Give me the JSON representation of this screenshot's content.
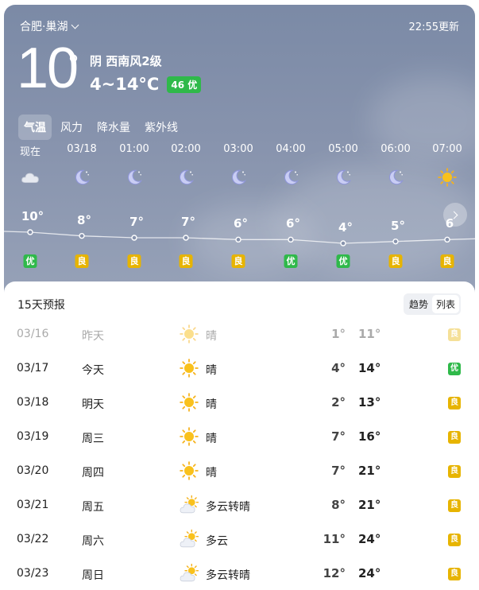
{
  "header": {
    "location": "合肥·巢湖",
    "update_time": "22:55更新",
    "current_temp": "10",
    "degree": "°",
    "weather_line": "阴  西南风2级",
    "temp_range": "4~14°C",
    "aqi_badge": "46 优"
  },
  "tabs": [
    "气温",
    "风力",
    "降水量",
    "紫外线"
  ],
  "hourly": [
    {
      "time": "现在",
      "icon": "cloud-icon",
      "temp": "10°",
      "t": 10,
      "aqi": "优"
    },
    {
      "time": "03/18",
      "icon": "moon-icon",
      "temp": "8°",
      "t": 8,
      "aqi": "良"
    },
    {
      "time": "01:00",
      "icon": "moon-icon",
      "temp": "7°",
      "t": 7,
      "aqi": "良"
    },
    {
      "time": "02:00",
      "icon": "moon-icon",
      "temp": "7°",
      "t": 7,
      "aqi": "良"
    },
    {
      "time": "03:00",
      "icon": "moon-icon",
      "temp": "6°",
      "t": 6,
      "aqi": "良"
    },
    {
      "time": "04:00",
      "icon": "moon-icon",
      "temp": "6°",
      "t": 6,
      "aqi": "优"
    },
    {
      "time": "05:00",
      "icon": "moon-icon",
      "temp": "4°",
      "t": 4,
      "aqi": "优"
    },
    {
      "time": "06:00",
      "icon": "moon-icon",
      "temp": "5°",
      "t": 5,
      "aqi": "良"
    },
    {
      "time": "07:00",
      "icon": "sun-icon",
      "temp": "6",
      "t": 6,
      "aqi": "良"
    }
  ],
  "forecast": {
    "title": "15天预报",
    "toggle": [
      "趋势",
      "列表"
    ],
    "days": [
      {
        "date": "03/16",
        "day": "昨天",
        "icon": "sun-icon",
        "desc": "晴",
        "lo": "1°",
        "hi": "11°",
        "aqi": "良",
        "past": true
      },
      {
        "date": "03/17",
        "day": "今天",
        "icon": "sun-icon",
        "desc": "晴",
        "lo": "4°",
        "hi": "14°",
        "aqi": "优",
        "past": false
      },
      {
        "date": "03/18",
        "day": "明天",
        "icon": "sun-icon",
        "desc": "晴",
        "lo": "2°",
        "hi": "13°",
        "aqi": "良",
        "past": false
      },
      {
        "date": "03/19",
        "day": "周三",
        "icon": "sun-icon",
        "desc": "晴",
        "lo": "7°",
        "hi": "16°",
        "aqi": "良",
        "past": false
      },
      {
        "date": "03/20",
        "day": "周四",
        "icon": "sun-icon",
        "desc": "晴",
        "lo": "7°",
        "hi": "21°",
        "aqi": "良",
        "past": false
      },
      {
        "date": "03/21",
        "day": "周五",
        "icon": "partly-cloudy-icon",
        "desc": "多云转晴",
        "lo": "8°",
        "hi": "21°",
        "aqi": "良",
        "past": false
      },
      {
        "date": "03/22",
        "day": "周六",
        "icon": "partly-cloudy-icon",
        "desc": "多云",
        "lo": "11°",
        "hi": "24°",
        "aqi": "良",
        "past": false
      },
      {
        "date": "03/23",
        "day": "周日",
        "icon": "partly-cloudy-icon",
        "desc": "多云转晴",
        "lo": "12°",
        "hi": "24°",
        "aqi": "良",
        "past": false
      }
    ]
  },
  "colors": {
    "good": "#2fb94a",
    "moderate": "#e7b400"
  }
}
